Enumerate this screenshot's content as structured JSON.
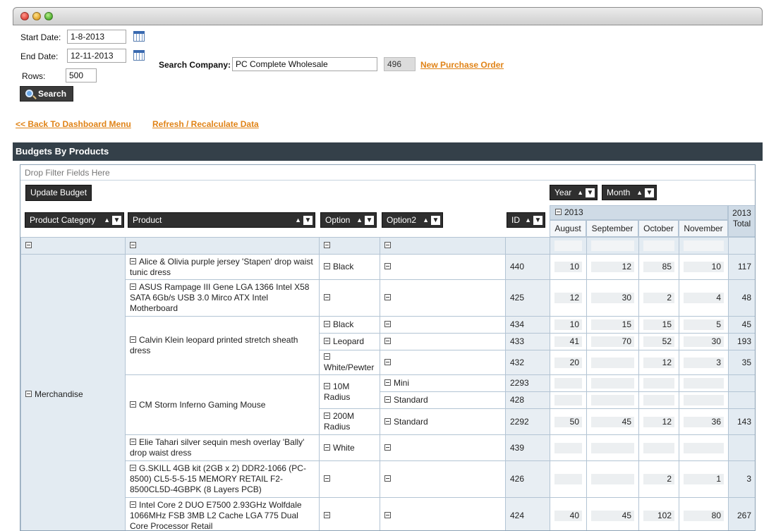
{
  "filters": {
    "start_label": "Start Date:",
    "start_value": "1-8-2013",
    "end_label": "End Date:",
    "end_value": "12-11-2013",
    "rows_label": "Rows:",
    "rows_value": "500",
    "search_label": "Search",
    "company_label": "Search Company:",
    "company_value": "PC Complete Wholesale",
    "company_id": "496",
    "new_po_link": "New Purchase Order"
  },
  "nav": {
    "back_link": "<< Back To Dashboard Menu",
    "refresh_link": "Refresh / Recalculate Data"
  },
  "section_title": "Budgets By Products",
  "pivot": {
    "drop_zone": "Drop Filter Fields Here",
    "update_button": "Update Budget",
    "col_fields": [
      "Year",
      "Month"
    ],
    "row_fields": [
      "Product Category",
      "Product",
      "Option",
      "Option2",
      "ID"
    ],
    "year": "2013",
    "months": [
      "August",
      "September",
      "October",
      "November"
    ],
    "total_label": "2013 Total",
    "category": "Merchandise",
    "rows": [
      {
        "product": "Alice & Olivia purple jersey 'Stapen' drop waist tunic dress",
        "option": "Black",
        "option2": "",
        "id": "440",
        "values": [
          "10",
          "12",
          "85",
          "10"
        ],
        "total": "117"
      },
      {
        "product": "ASUS Rampage III Gene LGA 1366 Intel X58 SATA 6Gb/s USB 3.0 Mirco ATX Intel Motherboard",
        "option": "",
        "option2": "",
        "id": "425",
        "values": [
          "12",
          "30",
          "2",
          "4"
        ],
        "total": "48"
      },
      {
        "product": "Calvin Klein leopard printed stretch sheath dress",
        "option": "Black",
        "option2": "",
        "id": "434",
        "values": [
          "10",
          "15",
          "15",
          "5"
        ],
        "total": "45"
      },
      {
        "product": "",
        "option": "Leopard",
        "option2": "",
        "id": "433",
        "values": [
          "41",
          "70",
          "52",
          "30"
        ],
        "total": "193"
      },
      {
        "product": "",
        "option": "White/Pewter",
        "option2": "",
        "id": "432",
        "values": [
          "20",
          "",
          "12",
          "3"
        ],
        "total": "35"
      },
      {
        "product": "CM Storm Inferno Gaming Mouse",
        "option": "10M Radius",
        "option2": "Mini",
        "id": "2293",
        "values": [
          "",
          "",
          "",
          ""
        ],
        "total": ""
      },
      {
        "product": "",
        "option": "",
        "option2": "Standard",
        "id": "428",
        "values": [
          "",
          "",
          "",
          ""
        ],
        "total": ""
      },
      {
        "product": "",
        "option": "200M Radius",
        "option2": "Standard",
        "id": "2292",
        "values": [
          "50",
          "45",
          "12",
          "36"
        ],
        "total": "143"
      },
      {
        "product": "Elie Tahari silver sequin mesh overlay 'Bally' drop waist dress",
        "option": "White",
        "option2": "",
        "id": "439",
        "values": [
          "",
          "",
          "",
          ""
        ],
        "total": ""
      },
      {
        "product": "G.SKILL 4GB kit (2GB x 2) DDR2-1066 (PC-8500) CL5-5-5-15 MEMORY RETAIL F2-8500CL5D-4GBPK (8 Layers PCB)",
        "option": "",
        "option2": "",
        "id": "426",
        "values": [
          "",
          "",
          "2",
          "1"
        ],
        "total": "3"
      },
      {
        "product": "Intel Core 2 DUO E7500 2.93GHz Wolfdale 1066MHz FSB 3MB L2 Cache LGA 775 Dual Core Processor Retail",
        "option": "",
        "option2": "",
        "id": "424",
        "values": [
          "40",
          "45",
          "102",
          "80"
        ],
        "total": "267"
      }
    ]
  }
}
